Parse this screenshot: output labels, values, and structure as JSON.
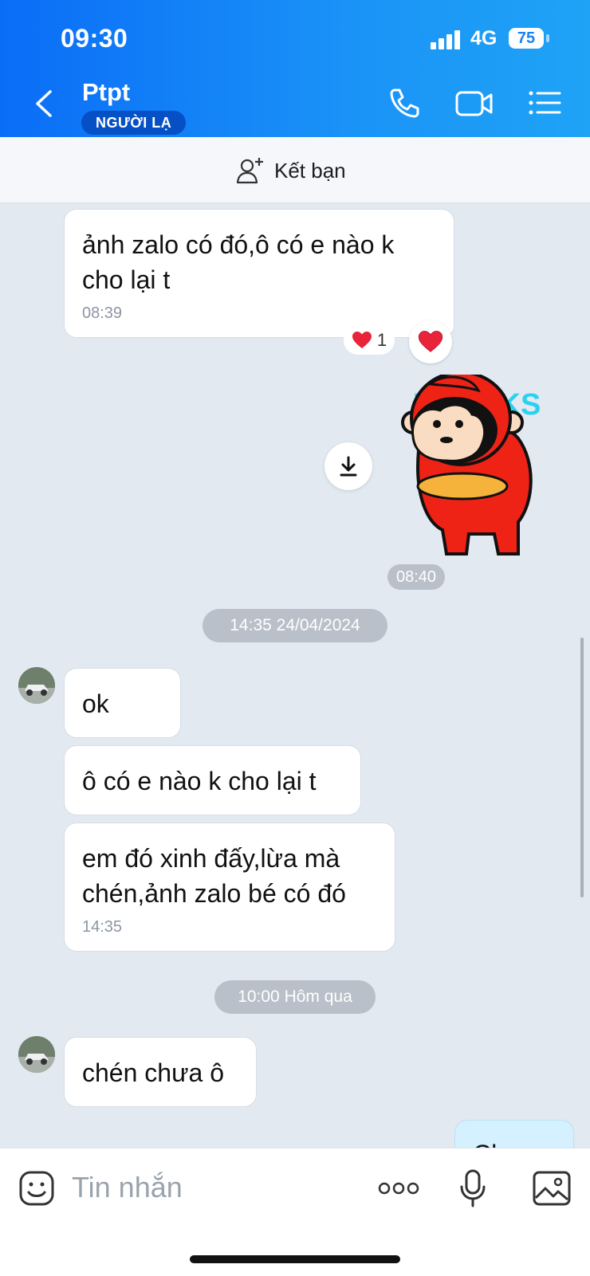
{
  "status_bar": {
    "time": "09:30",
    "network": "4G",
    "battery": "75"
  },
  "header": {
    "contact_name": "Ptpt",
    "badge": "NGƯỜI LẠ"
  },
  "friend_bar": {
    "label": "Kết bạn"
  },
  "messages": {
    "m1": {
      "text": "ảnh zalo có đó,ô có e nào k cho lại t",
      "time": "08:39",
      "reaction_count": "1"
    },
    "sticker": {
      "text": "THANKS",
      "time": "08:40"
    },
    "date1": "14:35 24/04/2024",
    "m2": {
      "text": "ok"
    },
    "m3": {
      "text": "ô có e nào k cho lại t"
    },
    "m4": {
      "text": "em đó xinh đấy,lừa mà chén,ảnh zalo bé có đó",
      "time": "14:35"
    },
    "date2": "10:00 Hôm qua",
    "m5": {
      "text": "chén chưa ô"
    },
    "m6_partial": {
      "text": "Ch..."
    }
  },
  "input": {
    "placeholder": "Tin nhắn"
  },
  "colors": {
    "header_start": "#0a6df7",
    "header_end": "#1fa3f6",
    "chat_bg": "#e2e9f1",
    "sent_bubble": "#d5f1ff",
    "heart": "#e8233a"
  }
}
